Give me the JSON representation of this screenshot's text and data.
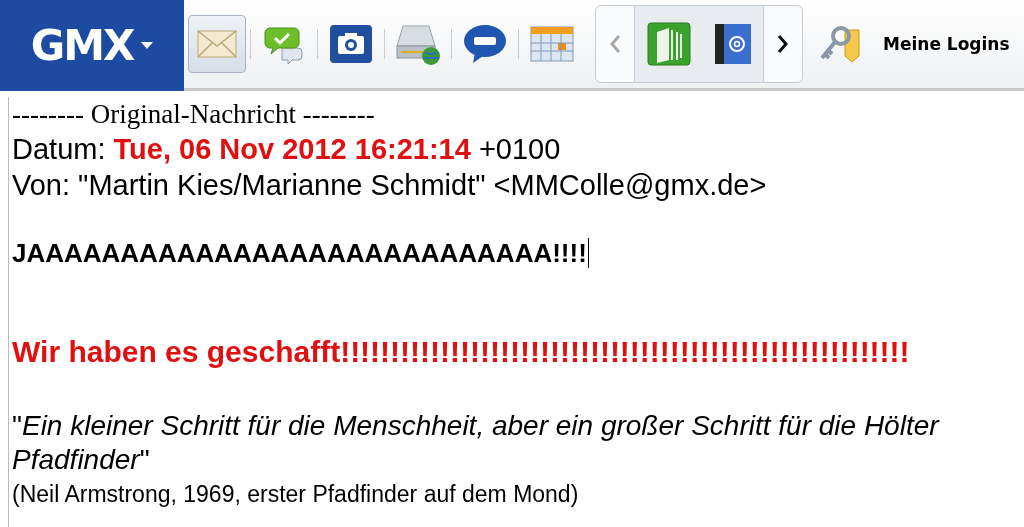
{
  "toolbar": {
    "logo": "GMX",
    "apps": [
      {
        "kind": "mail",
        "selected": true
      },
      {
        "kind": "chat",
        "selected": false
      },
      {
        "kind": "camera",
        "selected": false
      },
      {
        "kind": "drive",
        "selected": false
      },
      {
        "kind": "sms",
        "selected": false
      },
      {
        "kind": "calendar",
        "selected": false
      }
    ],
    "carousel": {
      "prev_disabled": true,
      "next_disabled": false,
      "items": [
        {
          "kind": "book"
        },
        {
          "kind": "contacts"
        }
      ]
    },
    "logins_label": "Meine Logins"
  },
  "message": {
    "separator": "-------- Original-Nachricht --------",
    "date_line": "Datum: **Tue, 06 Nov 2012 16:21:14** +0100",
    "from_line": "Von: \"Martin Kies/Marianne Schmidt\" <MMColle@gmx.de>",
    "shout": "JAAAAAAAAAAAAAAAAAAAAAAAAAAAA!!!!",
    "headline": "Wir haben es geschafft!!!!!!!!!!!!!!!!!!!!!!!!!!!!!!!!!!!!!!!!!!!!!!!!!!!!!!!!!",
    "quote": "\"*Ein kleiner Schritt für die Menschheit, aber ein großer Schritt für die Hölter Pfadfinder*\"",
    "attribution": "(Neil Armstrong, 1969, erster Pfadfinder auf dem Mond)"
  }
}
